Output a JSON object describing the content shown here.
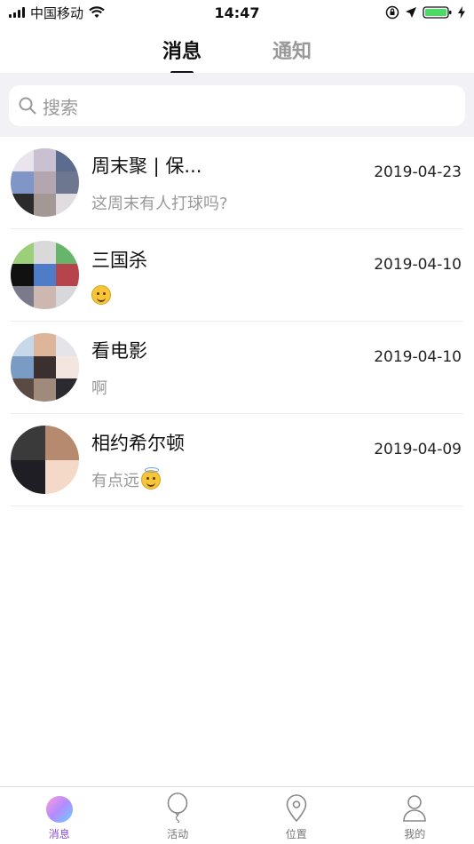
{
  "status_bar": {
    "carrier": "中国移动",
    "time": "14:47"
  },
  "top_tabs": [
    {
      "label": "消息",
      "active": true
    },
    {
      "label": "通知",
      "active": false
    }
  ],
  "search": {
    "placeholder": "搜索",
    "icon": "search-icon"
  },
  "conversations": [
    {
      "name": "周末聚 | 保...",
      "last_message": "这周末有人打球吗?",
      "date": "2019-04-23"
    },
    {
      "name": "三国杀",
      "last_message": "",
      "emoji": "smile",
      "date": "2019-04-10"
    },
    {
      "name": "看电影",
      "last_message": "啊",
      "date": "2019-04-10"
    },
    {
      "name": "相约希尔顿",
      "last_message": "有点远",
      "emoji": "halo-smile",
      "date": "2019-04-09"
    }
  ],
  "bottom_nav": [
    {
      "label": "消息",
      "icon": "messages-icon",
      "active": true
    },
    {
      "label": "活动",
      "icon": "balloon-icon",
      "active": false
    },
    {
      "label": "位置",
      "icon": "location-pin-icon",
      "active": false
    },
    {
      "label": "我的",
      "icon": "profile-icon",
      "active": false
    }
  ],
  "colors": {
    "accent": "#8a4fd6",
    "search_bg": "#f2f2f6",
    "muted_text": "#999999"
  }
}
